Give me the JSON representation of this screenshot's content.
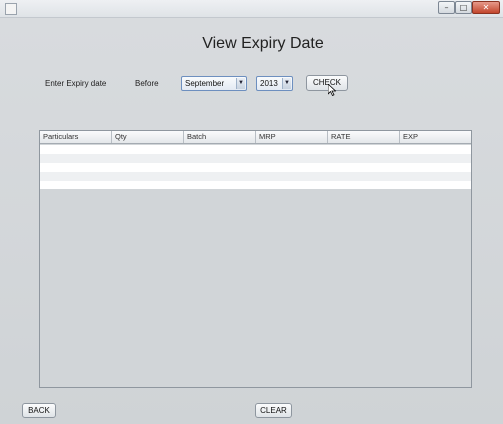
{
  "window": {
    "controls": {
      "minimize": "–",
      "maximize": "□",
      "close": "✕"
    }
  },
  "page": {
    "title": "View Expiry Date"
  },
  "filter": {
    "label": "Enter Expiry date",
    "before_label": "Before",
    "month": "September",
    "year": "2013",
    "check_button": "CHECK"
  },
  "table": {
    "columns": [
      "Particulars",
      "Qty",
      "Batch",
      "MRP",
      "RATE",
      "EXP"
    ]
  },
  "footer": {
    "back_button": "BACK",
    "clear_button": "CLEAR"
  },
  "icons": {
    "dropdown": "chevron-down-icon",
    "app": "app-icon",
    "pointer": "mouse-pointer-icon"
  }
}
